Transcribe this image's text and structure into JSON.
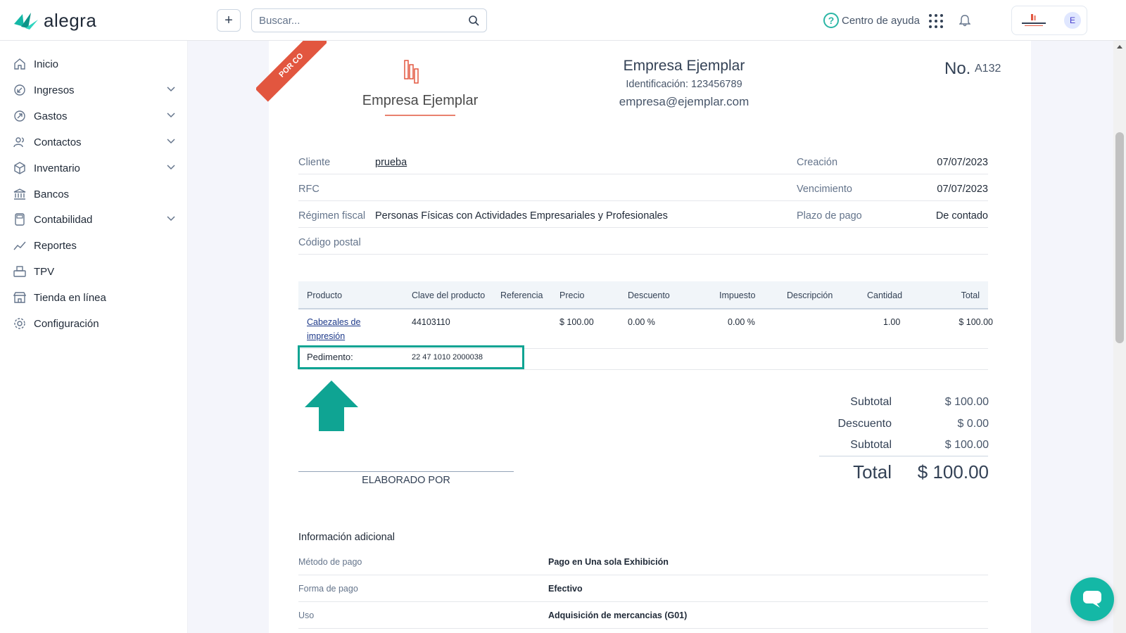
{
  "app": {
    "logo_text": "alegra"
  },
  "topbar": {
    "add_label": "+",
    "search_placeholder": "Buscar...",
    "help_label": "Centro de ayuda",
    "avatar_initial": "E"
  },
  "sidebar": {
    "items": [
      {
        "label": "Inicio",
        "icon": "home-icon",
        "expandable": false
      },
      {
        "label": "Ingresos",
        "icon": "income-icon",
        "expandable": true
      },
      {
        "label": "Gastos",
        "icon": "expense-icon",
        "expandable": true
      },
      {
        "label": "Contactos",
        "icon": "contacts-icon",
        "expandable": true
      },
      {
        "label": "Inventario",
        "icon": "box-icon",
        "expandable": true
      },
      {
        "label": "Bancos",
        "icon": "bank-icon",
        "expandable": false
      },
      {
        "label": "Contabilidad",
        "icon": "calculator-icon",
        "expandable": true
      },
      {
        "label": "Reportes",
        "icon": "chart-line-icon",
        "expandable": false
      },
      {
        "label": "TPV",
        "icon": "pos-icon",
        "expandable": false
      },
      {
        "label": "Tienda en línea",
        "icon": "store-icon",
        "expandable": false
      },
      {
        "label": "Configuración",
        "icon": "gear-icon",
        "expandable": false
      }
    ]
  },
  "invoice": {
    "ribbon": "POR CO",
    "logo_text": "Empresa Ejemplar",
    "company_name": "Empresa Ejemplar",
    "company_id": "Identificación: 123456789",
    "company_email": "empresa@ejemplar.com",
    "number_label": "No.",
    "number_value": "A132",
    "details": [
      {
        "k": "Cliente",
        "v": "prueba",
        "k2": "Creación",
        "v2": "07/07/2023"
      },
      {
        "k": "RFC",
        "v": "",
        "k2": "Vencimiento",
        "v2": "07/07/2023"
      },
      {
        "k": "Régimen fiscal",
        "v": "Personas Físicas con Actividades Empresariales y Profesionales",
        "k2": "Plazo de pago",
        "v2": "De contado"
      },
      {
        "k": "Código postal",
        "v": "",
        "k2": "",
        "v2": ""
      }
    ],
    "table_headers": [
      "Producto",
      "Clave del producto",
      "Referencia",
      "Precio",
      "Descuento",
      "Impuesto",
      "Descripción",
      "Cantidad",
      "Total"
    ],
    "item": {
      "product_line1": "Cabezales de",
      "product_line2": "impresión",
      "clave": "44103110",
      "referencia": "",
      "precio": "$ 100.00",
      "descuento": "0.00 %",
      "impuesto": "0.00 %",
      "descripcion": "",
      "cantidad": "1.00",
      "total": "$ 100.00"
    },
    "pedimento_label": "Pedimento:",
    "pedimento_value": "22 47 1010 2000038",
    "highlight_color": "#0fa493",
    "totals": [
      {
        "label": "Subtotal",
        "value": "$ 100.00"
      },
      {
        "label": "Descuento",
        "value": "$ 0.00"
      },
      {
        "label": "Subtotal",
        "value": "$ 100.00"
      }
    ],
    "grand_total_label": "Total",
    "grand_total_value": "$ 100.00",
    "signature_label": "ELABORADO POR",
    "extra_title": "Información adicional",
    "extra_rows": [
      {
        "k": "Método de pago",
        "v": "Pago en Una sola Exhibición"
      },
      {
        "k": "Forma de pago",
        "v": "Efectivo"
      },
      {
        "k": "Uso",
        "v": "Adquisición de mercancias (G01)"
      }
    ]
  },
  "colors": {
    "accent": "#2bb6a5",
    "ribbon": "#e2563f",
    "chat": "#14b8a6"
  }
}
